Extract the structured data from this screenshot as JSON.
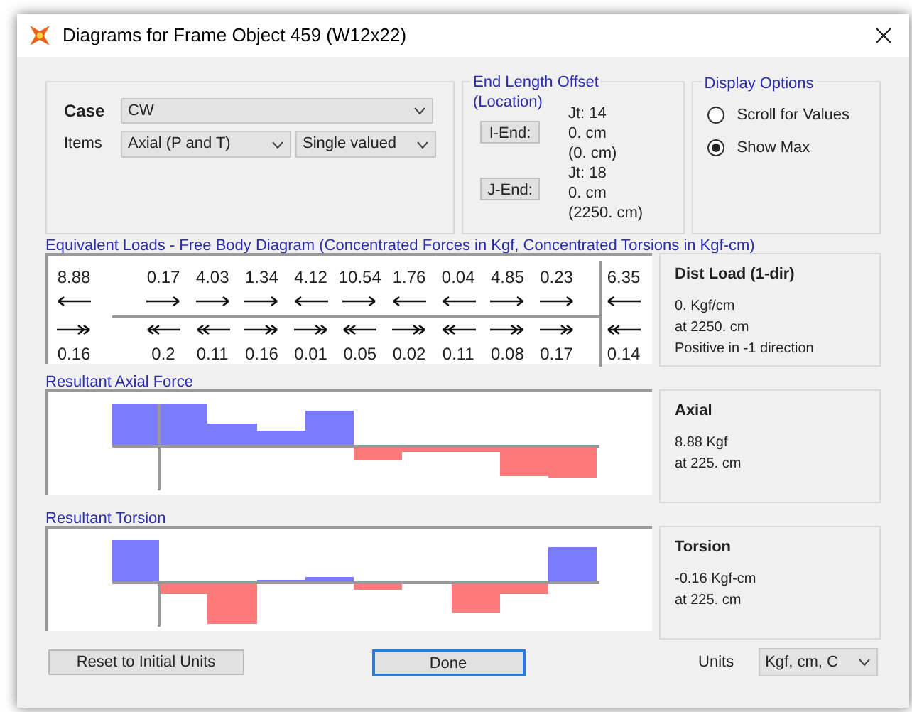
{
  "window": {
    "title": "Diagrams for Frame Object 459  (W12x22)"
  },
  "case": {
    "label": "Case",
    "value": "CW"
  },
  "items": {
    "label": "Items",
    "value": "Axial (P and T)",
    "mode": "Single valued"
  },
  "end_length_offset": {
    "title_lines": [
      "End Length Offset",
      "(Location)"
    ],
    "i_end": {
      "button": "I-End:",
      "joint": "Jt:  14",
      "offset": "0. cm",
      "location": "(0. cm)"
    },
    "j_end": {
      "button": "J-End:",
      "joint": "Jt:  18",
      "offset": "0. cm",
      "location": "(2250. cm)"
    }
  },
  "display_options": {
    "title": "Display Options",
    "options": [
      {
        "label": "Scroll for Values",
        "selected": false
      },
      {
        "label": "Show Max",
        "selected": true
      }
    ]
  },
  "free_body": {
    "title": "Equivalent Loads - Free Body Diagram  (Concentrated Forces in Kgf, Concentrated Torsions in Kgf-cm)",
    "loads": [
      {
        "force": "8.88",
        "force_points_left": true,
        "torsion": "0.16",
        "torsion_points_left": false
      },
      {
        "force": "0.17",
        "force_points_left": false,
        "torsion": "0.2",
        "torsion_points_left": true
      },
      {
        "force": "4.03",
        "force_points_left": false,
        "torsion": "0.11",
        "torsion_points_left": true
      },
      {
        "force": "1.34",
        "force_points_left": false,
        "torsion": "0.16",
        "torsion_points_left": false
      },
      {
        "force": "4.12",
        "force_points_left": true,
        "torsion": "0.01",
        "torsion_points_left": false
      },
      {
        "force": "10.54",
        "force_points_left": false,
        "torsion": "0.05",
        "torsion_points_left": true
      },
      {
        "force": "1.76",
        "force_points_left": true,
        "torsion": "0.02",
        "torsion_points_left": false
      },
      {
        "force": "0.04",
        "force_points_left": true,
        "torsion": "0.11",
        "torsion_points_left": true
      },
      {
        "force": "4.85",
        "force_points_left": false,
        "torsion": "0.08",
        "torsion_points_left": false
      },
      {
        "force": "0.23",
        "force_points_left": false,
        "torsion": "0.17",
        "torsion_points_left": false
      },
      {
        "force": "6.35",
        "force_points_left": true,
        "torsion": "0.14",
        "torsion_points_left": true
      }
    ],
    "info": {
      "title": "Dist Load (1-dir)",
      "lines": [
        "0. Kgf/cm",
        "at 2250. cm",
        "Positive in -1 direction"
      ]
    }
  },
  "axial": {
    "title": "Resultant Axial Force",
    "info": {
      "title": "Axial",
      "lines": [
        "8.88 Kgf",
        "at 225. cm"
      ]
    }
  },
  "torsion": {
    "title": "Resultant Torsion",
    "info": {
      "title": "Torsion",
      "lines": [
        "-0.16 Kgf-cm",
        "at 225. cm"
      ]
    }
  },
  "buttons": {
    "reset": "Reset to Initial Units",
    "done": "Done"
  },
  "units": {
    "label": "Units",
    "value": "Kgf, cm, C"
  }
}
